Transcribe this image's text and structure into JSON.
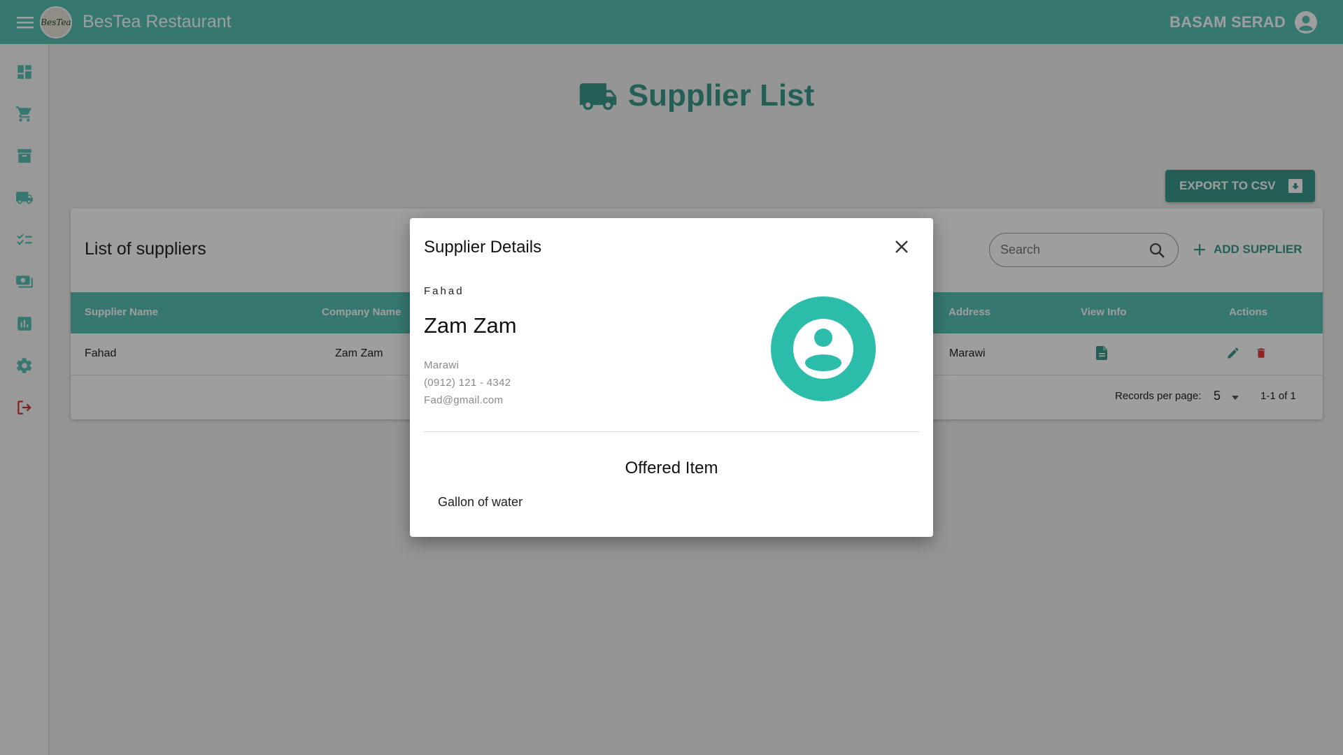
{
  "app": {
    "title": "BesTea Restaurant",
    "logo_text": "BesTea",
    "user_name": "BASAM SERAD"
  },
  "sidebar": {
    "items": [
      {
        "icon": "dashboard-icon"
      },
      {
        "icon": "cart-icon"
      },
      {
        "icon": "archive-icon"
      },
      {
        "icon": "truck-icon"
      },
      {
        "icon": "checklist-icon"
      },
      {
        "icon": "payments-icon"
      },
      {
        "icon": "report-icon"
      },
      {
        "icon": "gear-icon"
      },
      {
        "icon": "logout-icon"
      }
    ]
  },
  "page": {
    "title": "Supplier List",
    "export_label": "EXPORT TO CSV"
  },
  "card": {
    "title": "List of suppliers",
    "search_placeholder": "Search",
    "add_label": "ADD SUPPLIER",
    "columns": [
      "Supplier Name",
      "Company Name",
      "Address",
      "View Info",
      "Actions"
    ],
    "rows": [
      {
        "supplier_name": "Fahad",
        "company_name": "Zam Zam",
        "address": "Marawi"
      }
    ],
    "records_per_page_label": "Records per page:",
    "records_per_page": "5",
    "range": "1-1 of 1"
  },
  "dialog": {
    "title": "Supplier Details",
    "contact_name": "Fahad",
    "company": "Zam Zam",
    "address": "Marawi",
    "phone": "(0912) 121 - 4342",
    "email": "Fad@gmail.com",
    "offered_title": "Offered Item",
    "offered_items": [
      "Gallon of water"
    ]
  },
  "colors": {
    "primary": "#57c2b5",
    "primary_dark": "#3a9a8d",
    "avatar": "#2bbcaa",
    "danger": "#e53935",
    "logout": "#d32f2f"
  }
}
